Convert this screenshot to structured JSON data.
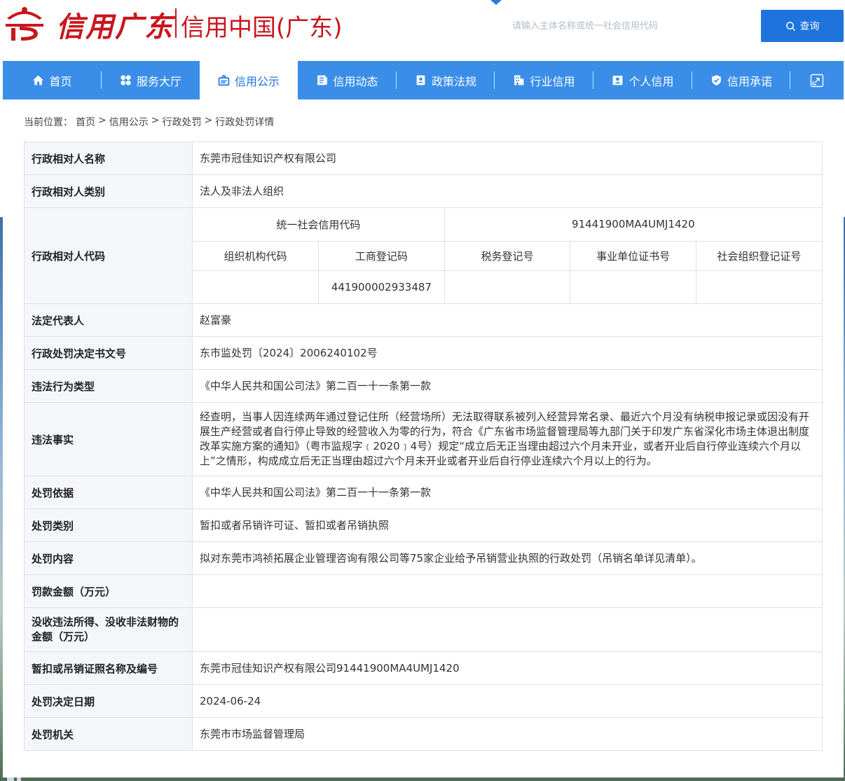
{
  "header": {
    "logo_script": "信用广东",
    "logo_text": "信用中国(广东)",
    "search_placeholder": "请输入主体名称或统一社会信用代码",
    "search_button": "查询"
  },
  "nav": {
    "items": [
      {
        "label": "首页",
        "icon": "home-icon"
      },
      {
        "label": "服务大厅",
        "icon": "grid-icon"
      },
      {
        "label": "信用公示",
        "icon": "publicity-icon",
        "active": true
      },
      {
        "label": "信用动态",
        "icon": "news-icon"
      },
      {
        "label": "政策法规",
        "icon": "policy-icon"
      },
      {
        "label": "行业信用",
        "icon": "building-icon"
      },
      {
        "label": "个人信用",
        "icon": "id-card-icon"
      },
      {
        "label": "信用承诺",
        "icon": "shield-check-icon"
      },
      {
        "label": "",
        "icon": "fullscreen-icon"
      }
    ]
  },
  "breadcrumb": {
    "prefix": "当前位置：",
    "items": [
      "首页",
      "信用公示",
      "行政处罚",
      "行政处罚详情"
    ],
    "sep": ">"
  },
  "detail": {
    "name_label": "行政相对人名称",
    "name_value": "东莞市冠佳知识产权有限公司",
    "type_label": "行政相对人类别",
    "type_value": "法人及非法人组织",
    "code_label": "行政相对人代码",
    "uscc_label": "统一社会信用代码",
    "uscc_value": "91441900MA4UMJ1420",
    "code_headers": [
      "组织机构代码",
      "工商登记码",
      "税务登记号",
      "事业单位证书号",
      "社会组织登记证号"
    ],
    "code_values": [
      "",
      "441900002933487",
      "",
      "",
      ""
    ],
    "legal_rep_label": "法定代表人",
    "legal_rep_value": "赵富豪",
    "doc_no_label": "行政处罚决定书文号",
    "doc_no_value": "东市监处罚〔2024〕2006240102号",
    "violation_type_label": "违法行为类型",
    "violation_type_value": "《中华人民共和国公司法》第二百一十一条第一款",
    "facts_label": "违法事实",
    "facts_value": "经查明，当事人因连续两年通过登记住所（经营场所）无法取得联系被列入经营异常名录、最近六个月没有纳税申报记录或因没有开展生产经营或者自行停止导致的经营收入为零的行为，符合《广东省市场监督管理局等九部门关于印发广东省深化市场主体退出制度改革实施方案的通知》（粤市监规字﹝2020﹞4号）规定“成立后无正当理由超过六个月未开业，或者开业后自行停业连续六个月以上”之情形，构成成立后无正当理由超过六个月未开业或者开业后自行停业连续六个月以上的行为。",
    "basis_label": "处罚依据",
    "basis_value": "《中华人民共和国公司法》第二百一十一条第一款",
    "category_label": "处罚类别",
    "category_value": "暂扣或者吊销许可证、暂扣或者吊销执照",
    "content_label": "处罚内容",
    "content_value": "拟对东莞市鸿祯拓展企业管理咨询有限公司等75家企业给予吊销营业执照的行政处罚（吊销名单详见清单）。",
    "fine_label": "罚款金额（万元）",
    "fine_value": "",
    "confiscation_label": "没收违法所得、没收非法财物的金额（万元）",
    "confiscation_value": "",
    "license_label": "暂扣或吊销证照名称及编号",
    "license_value": "东莞市冠佳知识产权有限公司91441900MA4UMJ1420",
    "date_label": "处罚决定日期",
    "date_value": "2024-06-24",
    "authority_label": "处罚机关",
    "authority_value": "东莞市市场监督管理局"
  },
  "colors": {
    "brand_red": "#c8161d",
    "nav_blue": "#3a8ee8",
    "button_blue": "#1e73dc"
  }
}
